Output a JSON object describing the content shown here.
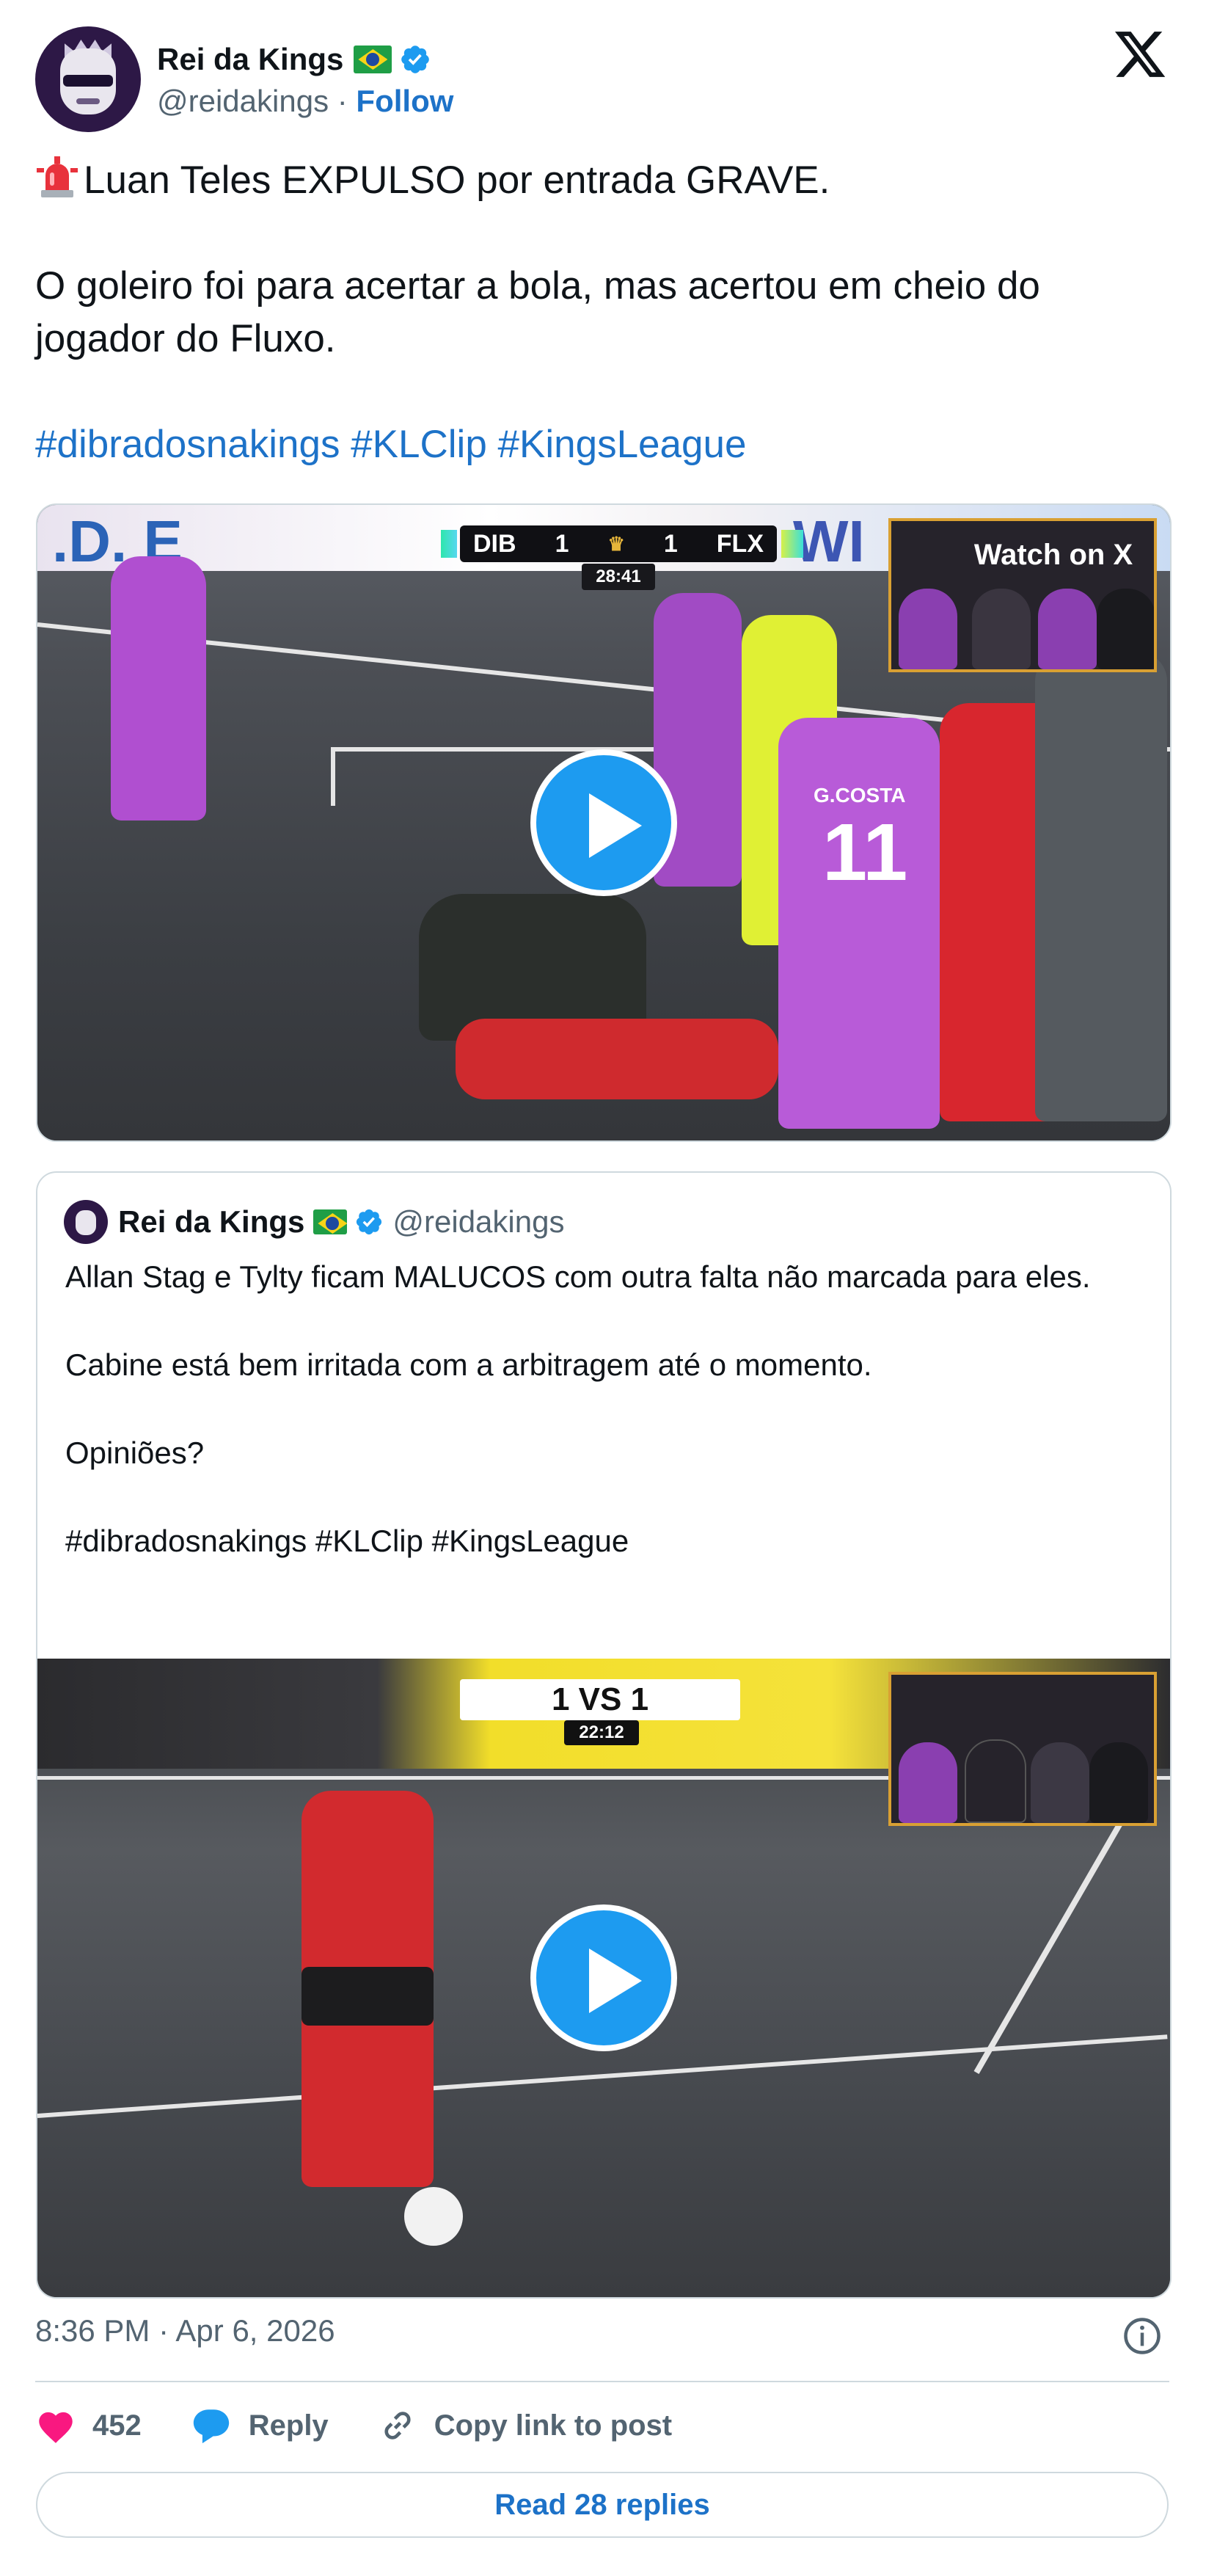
{
  "author": {
    "name": "Rei da Kings",
    "flag": "🇧🇷",
    "handle": "@reidakings",
    "separator": "·",
    "follow_label": "Follow"
  },
  "tweet": {
    "line1": "Luan Teles EXPULSO por entrada GRAVE.",
    "line2": "O goleiro foi para acertar a bola, mas acertou em cheio do jogador do Fluxo.",
    "hashtags": "#dibradosnakings #KLClip #KingsLeague"
  },
  "video1": {
    "scoreboard": {
      "home": "DIB",
      "home_score": "1",
      "away_score": "1",
      "away": "FLX",
      "clock": "28:41"
    },
    "watch_label": "Watch on X",
    "jersey_name": "G.COSTA",
    "jersey_number": "11"
  },
  "quote": {
    "name": "Rei da Kings",
    "handle": "@reidakings",
    "line1": "Allan Stag e Tylty ficam MALUCOS com outra falta não marcada para eles.",
    "line2": "Cabine está bem irritada com a arbitragem até o momento.",
    "line3": "Opiniões?",
    "hashtags": "#dibradosnakings #KLClip #KingsLeague",
    "video": {
      "score": "1 VS 1",
      "clock": "22:12"
    }
  },
  "footer": {
    "timestamp": "8:36 PM · Apr 6, 2026",
    "likes": "452",
    "reply_label": "Reply",
    "copy_label": "Copy link to post",
    "read_replies": "Read 28 replies"
  },
  "colors": {
    "link": "#1d72c8",
    "like": "#f91880",
    "reply": "#1d9bf0",
    "muted": "#536471"
  }
}
